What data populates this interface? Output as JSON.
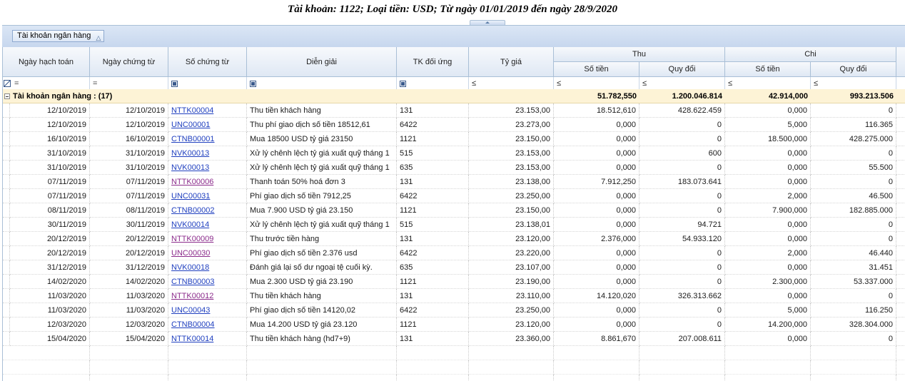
{
  "title": "Tài khoản: 1122; Loại tiền: USD; Từ ngày 01/01/2019 đến ngày 28/9/2020",
  "group_panel": {
    "chip_label": "Tài khoản ngân hàng",
    "chip_sort": "△"
  },
  "columns": {
    "ngay_hach_toan": "Ngày hạch toán",
    "ngay_chung_tu": "Ngày chứng từ",
    "so_chung_tu": "Số chứng từ",
    "dien_giai": "Diễn giải",
    "tk_doi_ung": "TK đối ứng",
    "ty_gia": "Tỷ giá",
    "thu": "Thu",
    "chi": "Chi",
    "so_tien": "Số tiền",
    "quy_doi": "Quy đổi"
  },
  "filters": {
    "eq": "=",
    "le": "≤"
  },
  "group_row": {
    "label": "Tài khoản ngân hàng : (17)",
    "thu_so_tien": "51.782,550",
    "thu_quy_doi": "1.200.046.814",
    "chi_so_tien": "42.914,000",
    "chi_quy_doi": "993.213.506"
  },
  "rows": [
    {
      "ht": "12/10/2019",
      "ct": "12/10/2019",
      "so": "NTTK00004",
      "dg": "Thu tiền khách hàng",
      "tk": "131",
      "tg": "23.153,00",
      "ts": "18.512,610",
      "tq": "428.622.459",
      "cs": "0,000",
      "cq": "0",
      "visited": false
    },
    {
      "ht": "12/10/2019",
      "ct": "12/10/2019",
      "so": "UNC00001",
      "dg": "Thu phí giao dịch số tiền 18512,61",
      "tk": "6422",
      "tg": "23.273,00",
      "ts": "0,000",
      "tq": "0",
      "cs": "5,000",
      "cq": "116.365",
      "visited": false
    },
    {
      "ht": "16/10/2019",
      "ct": "16/10/2019",
      "so": "CTNB00001",
      "dg": "Mua 18500 USD tỷ giá 23150",
      "tk": "1121",
      "tg": "23.150,00",
      "ts": "0,000",
      "tq": "0",
      "cs": "18.500,000",
      "cq": "428.275.000",
      "visited": false
    },
    {
      "ht": "31/10/2019",
      "ct": "31/10/2019",
      "so": "NVK00013",
      "dg": "Xử lý chênh lệch tỷ giá xuất quỹ tháng 1",
      "tk": "515",
      "tg": "23.153,00",
      "ts": "0,000",
      "tq": "600",
      "cs": "0,000",
      "cq": "0",
      "visited": false
    },
    {
      "ht": "31/10/2019",
      "ct": "31/10/2019",
      "so": "NVK00013",
      "dg": "Xử lý chênh lệch tỷ giá xuất quỹ tháng 1",
      "tk": "635",
      "tg": "23.153,00",
      "ts": "0,000",
      "tq": "0",
      "cs": "0,000",
      "cq": "55.500",
      "visited": false
    },
    {
      "ht": "07/11/2019",
      "ct": "07/11/2019",
      "so": "NTTK00006",
      "dg": "Thanh toán 50% hoá đơn 3",
      "tk": "131",
      "tg": "23.138,00",
      "ts": "7.912,250",
      "tq": "183.073.641",
      "cs": "0,000",
      "cq": "0",
      "visited": true
    },
    {
      "ht": "07/11/2019",
      "ct": "07/11/2019",
      "so": "UNC00031",
      "dg": "Phí giao dịch số tiền 7912,25",
      "tk": "6422",
      "tg": "23.250,00",
      "ts": "0,000",
      "tq": "0",
      "cs": "2,000",
      "cq": "46.500",
      "visited": false
    },
    {
      "ht": "08/11/2019",
      "ct": "08/11/2019",
      "so": "CTNB00002",
      "dg": "Mua 7.900 USD tỷ giá 23.150",
      "tk": "1121",
      "tg": "23.150,00",
      "ts": "0,000",
      "tq": "0",
      "cs": "7.900,000",
      "cq": "182.885.000",
      "visited": false
    },
    {
      "ht": "30/11/2019",
      "ct": "30/11/2019",
      "so": "NVK00014",
      "dg": "Xử lý chênh lệch tỷ giá xuất quỹ tháng 1",
      "tk": "515",
      "tg": "23.138,01",
      "ts": "0,000",
      "tq": "94.721",
      "cs": "0,000",
      "cq": "0",
      "visited": false
    },
    {
      "ht": "20/12/2019",
      "ct": "20/12/2019",
      "so": "NTTK00009",
      "dg": "Thu trước tiền hàng",
      "tk": "131",
      "tg": "23.120,00",
      "ts": "2.376,000",
      "tq": "54.933.120",
      "cs": "0,000",
      "cq": "0",
      "visited": true
    },
    {
      "ht": "20/12/2019",
      "ct": "20/12/2019",
      "so": "UNC00030",
      "dg": "Phí giao dịch số tiền 2.376 usd",
      "tk": "6422",
      "tg": "23.220,00",
      "ts": "0,000",
      "tq": "0",
      "cs": "2,000",
      "cq": "46.440",
      "visited": true
    },
    {
      "ht": "31/12/2019",
      "ct": "31/12/2019",
      "so": "NVK00018",
      "dg": "Đánh giá lại số dư ngoại tệ cuối kỳ.",
      "tk": "635",
      "tg": "23.107,00",
      "ts": "0,000",
      "tq": "0",
      "cs": "0,000",
      "cq": "31.451",
      "visited": false
    },
    {
      "ht": "14/02/2020",
      "ct": "14/02/2020",
      "so": "CTNB00003",
      "dg": "Mua 2.300 USD tỷ giá 23.190",
      "tk": "1121",
      "tg": "23.190,00",
      "ts": "0,000",
      "tq": "0",
      "cs": "2.300,000",
      "cq": "53.337.000",
      "visited": false
    },
    {
      "ht": "11/03/2020",
      "ct": "11/03/2020",
      "so": "NTTK00012",
      "dg": "Thu tiền khách hàng",
      "tk": "131",
      "tg": "23.110,00",
      "ts": "14.120,020",
      "tq": "326.313.662",
      "cs": "0,000",
      "cq": "0",
      "visited": true
    },
    {
      "ht": "11/03/2020",
      "ct": "11/03/2020",
      "so": "UNC00043",
      "dg": "Phí giao dịch số tiền 14120,02",
      "tk": "6422",
      "tg": "23.250,00",
      "ts": "0,000",
      "tq": "0",
      "cs": "5,000",
      "cq": "116.250",
      "visited": false
    },
    {
      "ht": "12/03/2020",
      "ct": "12/03/2020",
      "so": "CTNB00004",
      "dg": "Mua 14.200 USD tỷ giá 23.120",
      "tk": "1121",
      "tg": "23.120,00",
      "ts": "0,000",
      "tq": "0",
      "cs": "14.200,000",
      "cq": "328.304.000",
      "visited": false
    },
    {
      "ht": "15/04/2020",
      "ct": "15/04/2020",
      "so": "NTTK00014",
      "dg": "Thu tiền khách hàng (hd7+9)",
      "tk": "131",
      "tg": "23.360,00",
      "ts": "8.861,670",
      "tq": "207.008.611",
      "cs": "0,000",
      "cq": "0",
      "visited": false
    }
  ],
  "colors": {
    "group_row_bg": "#fdf3d6",
    "link": "#1f3fbf",
    "link_visited": "#8b2b8b",
    "header_bg": "#dfe8f4"
  }
}
